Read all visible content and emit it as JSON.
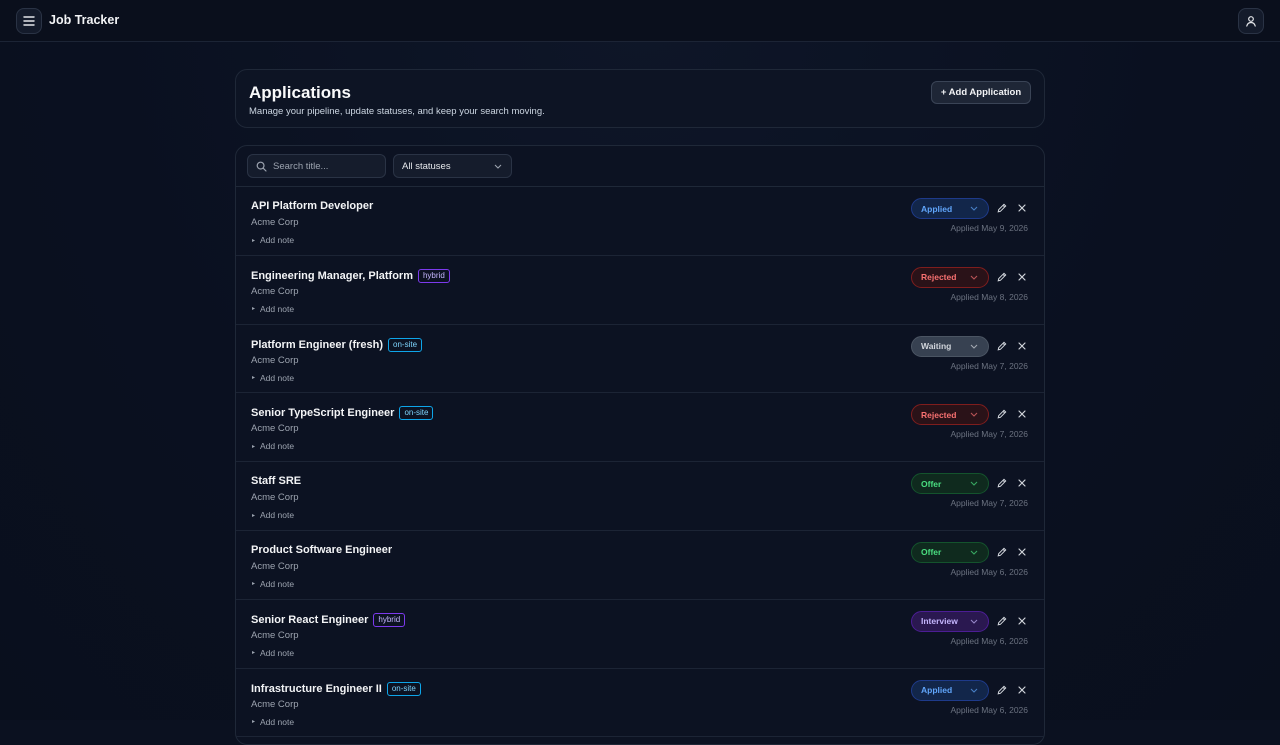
{
  "app": {
    "title": "Job Tracker",
    "menu_icon": "hamburger-menu-icon",
    "user_icon": "user-icon"
  },
  "header": {
    "title": "Applications",
    "subtitle": "Manage your pipeline, update statuses, and keep your search moving.",
    "add_button": "+ Add Application"
  },
  "filters": {
    "search_placeholder": "Search title...",
    "status_selected": "All statuses"
  },
  "colors": {
    "background": "#0b1120",
    "applied": "#60a5fa",
    "rejected": "#f87171",
    "waiting": "#d1d5db",
    "offer": "#4ade80",
    "interview": "#c4b5fd"
  },
  "rows": [
    {
      "title": "API Platform Developer",
      "tag": "",
      "company": "Acme Corp",
      "note": "Add note",
      "status": "Applied",
      "status_class": "applied",
      "date": "Applied May 9, 2026"
    },
    {
      "title": "Engineering Manager, Platform",
      "tag": "hybrid",
      "company": "Acme Corp",
      "note": "Add note",
      "status": "Rejected",
      "status_class": "rejected",
      "date": "Applied May 8, 2026"
    },
    {
      "title": "Platform Engineer (fresh)",
      "tag": "on-site",
      "company": "Acme Corp",
      "note": "Add note",
      "status": "Waiting",
      "status_class": "waiting",
      "date": "Applied May 7, 2026"
    },
    {
      "title": "Senior TypeScript Engineer",
      "tag": "on-site",
      "company": "Acme Corp",
      "note": "Add note",
      "status": "Rejected",
      "status_class": "rejected",
      "date": "Applied May 7, 2026"
    },
    {
      "title": "Staff SRE",
      "tag": "",
      "company": "Acme Corp",
      "note": "Add note",
      "status": "Offer",
      "status_class": "offer",
      "date": "Applied May 7, 2026"
    },
    {
      "title": "Product Software Engineer",
      "tag": "",
      "company": "Acme Corp",
      "note": "Add note",
      "status": "Offer",
      "status_class": "offer",
      "date": "Applied May 6, 2026"
    },
    {
      "title": "Senior React Engineer",
      "tag": "hybrid",
      "company": "Acme Corp",
      "note": "Add note",
      "status": "Interview",
      "status_class": "interview",
      "date": "Applied May 6, 2026"
    },
    {
      "title": "Infrastructure Engineer II",
      "tag": "on-site",
      "company": "Acme Corp",
      "note": "Add note",
      "status": "Applied",
      "status_class": "applied",
      "date": "Applied May 6, 2026"
    }
  ]
}
